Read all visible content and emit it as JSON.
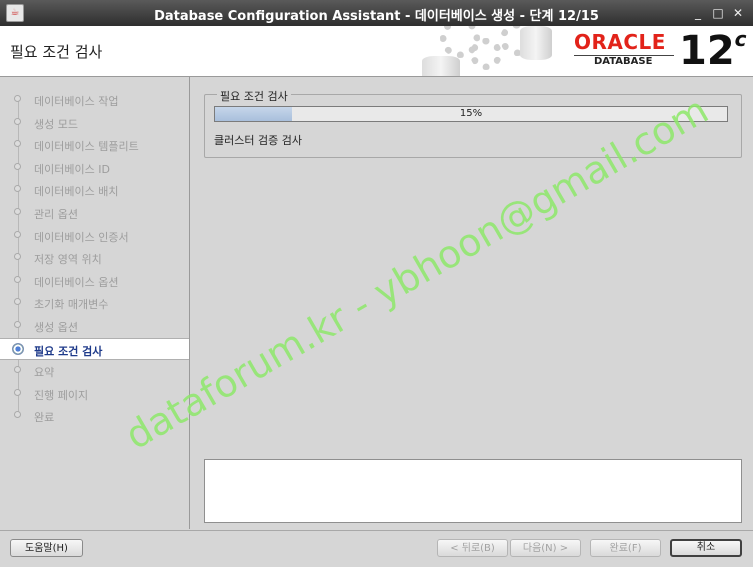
{
  "window": {
    "title": "Database Configuration Assistant - 데이터베이스 생성 - 단계 12/15",
    "icon": "java-icon",
    "controls": [
      "minimize-icon",
      "maximize-icon",
      "close-icon"
    ]
  },
  "header": {
    "page_title": "필요 조건 검사",
    "logo_text": "ORACLE",
    "logo_subtext": "DATABASE",
    "version": "12",
    "version_suffix": "c"
  },
  "steps": [
    {
      "label": "데이터베이스 작업",
      "state": "done"
    },
    {
      "label": "생성 모드",
      "state": "done"
    },
    {
      "label": "데이터베이스 템플리트",
      "state": "done"
    },
    {
      "label": "데이터베이스 ID",
      "state": "done"
    },
    {
      "label": "데이터베이스 배치",
      "state": "done"
    },
    {
      "label": "관리 옵션",
      "state": "done"
    },
    {
      "label": "데이터베이스 인증서",
      "state": "done"
    },
    {
      "label": "저장 영역 위치",
      "state": "done"
    },
    {
      "label": "데이터베이스 옵션",
      "state": "done"
    },
    {
      "label": "초기화 매개변수",
      "state": "done"
    },
    {
      "label": "생성 옵션",
      "state": "done"
    },
    {
      "label": "필요 조건 검사",
      "state": "current"
    },
    {
      "label": "요약",
      "state": "pending"
    },
    {
      "label": "진행 페이지",
      "state": "pending"
    },
    {
      "label": "완료",
      "state": "pending"
    }
  ],
  "main": {
    "group_title": "필요 조건 검사",
    "progress_value": 15,
    "progress_text": "15%",
    "status_text": "클러스터 검증 검사",
    "detail_text": ""
  },
  "watermark": "dataforum.kr - ybhoon@gmail.com",
  "footer": {
    "help": "도움말(H)",
    "back": "< 뒤로(B)",
    "next": "다음(N) >",
    "finish": "완료(F)",
    "cancel": "취소"
  },
  "colors": {
    "accent": "#e2231a",
    "current_step": "#1e3a8a",
    "watermark": "#8ee86a",
    "progress_fill": "#b7cae3"
  }
}
